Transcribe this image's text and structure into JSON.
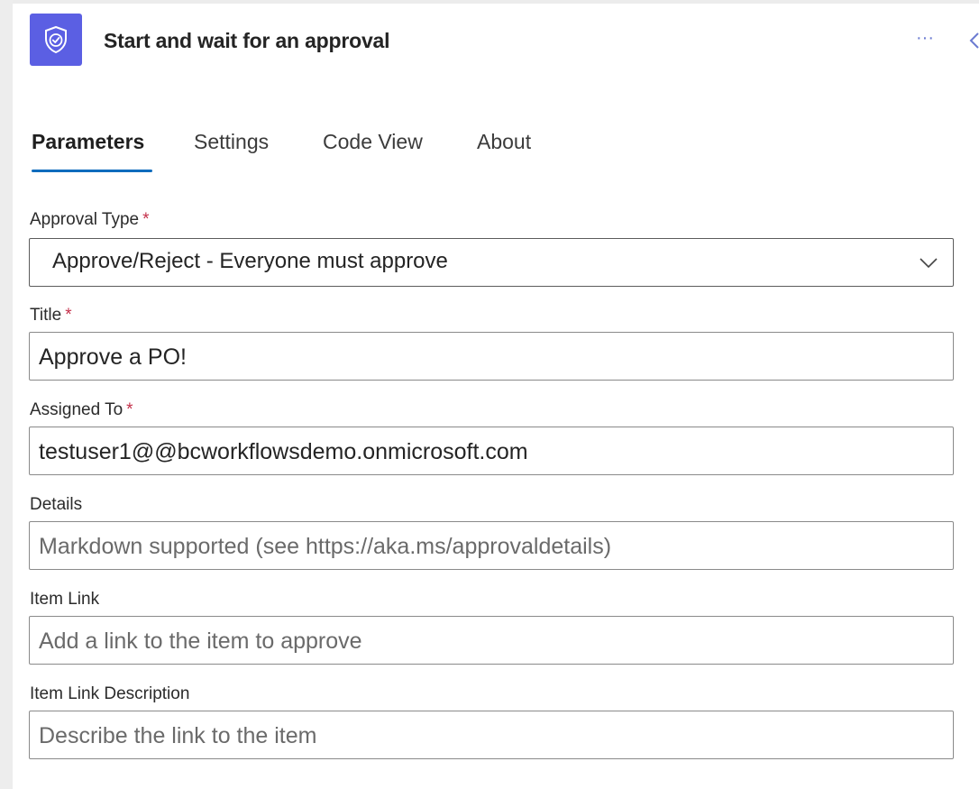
{
  "header": {
    "title": "Start and wait for an approval",
    "icon": "approval-icon",
    "icon_color": "#5b5fe3",
    "more_label": "···"
  },
  "tabs": [
    {
      "label": "Parameters",
      "active": true
    },
    {
      "label": "Settings",
      "active": false
    },
    {
      "label": "Code View",
      "active": false
    },
    {
      "label": "About",
      "active": false
    }
  ],
  "accent_color": "#0f6cbd",
  "required_marker": "*",
  "fields": {
    "approval_type": {
      "label": "Approval Type",
      "required": true,
      "value": "Approve/Reject - Everyone must approve"
    },
    "title": {
      "label": "Title",
      "required": true,
      "value": "Approve a PO!"
    },
    "assigned_to": {
      "label": "Assigned To",
      "required": true,
      "value": "testuser1@@bcworkflowsdemo.onmicrosoft.com"
    },
    "details": {
      "label": "Details",
      "required": false,
      "placeholder": "Markdown supported (see https://aka.ms/approvaldetails)"
    },
    "item_link": {
      "label": "Item Link",
      "required": false,
      "placeholder": "Add a link to the item to approve"
    },
    "item_link_description": {
      "label": "Item Link Description",
      "required": false,
      "placeholder": "Describe the link to the item"
    }
  }
}
